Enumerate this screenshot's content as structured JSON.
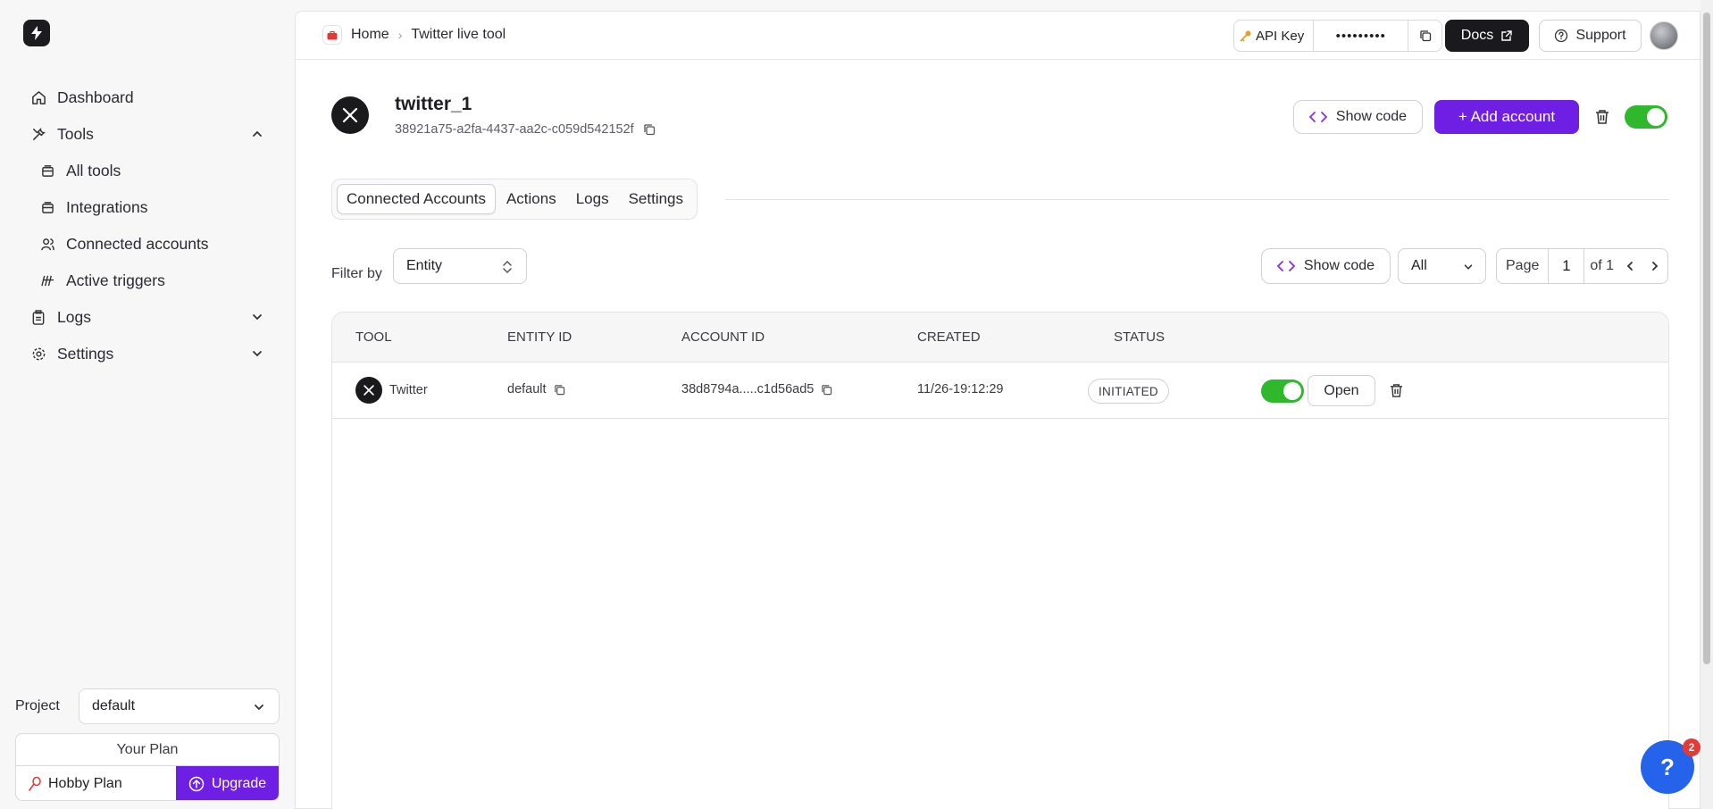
{
  "sidebar": {
    "items": [
      {
        "label": "Dashboard",
        "icon": "home-icon"
      },
      {
        "label": "Tools",
        "icon": "tools-icon"
      },
      {
        "label": "All tools",
        "icon": "grid-icon"
      },
      {
        "label": "Integrations",
        "icon": "integration-icon"
      },
      {
        "label": "Connected accounts",
        "icon": "users-icon"
      },
      {
        "label": "Active triggers",
        "icon": "trigger-icon"
      },
      {
        "label": "Logs",
        "icon": "clipboard-icon"
      },
      {
        "label": "Settings",
        "icon": "gear-icon"
      }
    ],
    "project_label": "Project",
    "project_value": "default",
    "plan_title": "Your Plan",
    "plan_name": "Hobby Plan",
    "upgrade_label": "Upgrade"
  },
  "header": {
    "breadcrumb_home": "Home",
    "breadcrumb_current": "Twitter live tool",
    "api_key_label": "API Key",
    "api_key_value": "•••••••••",
    "docs_label": "Docs",
    "support_label": "Support"
  },
  "tool": {
    "name": "twitter_1",
    "id": "38921a75-a2fa-4437-aa2c-c059d542152f",
    "show_code_label": "Show code",
    "add_account_label": "+ Add account"
  },
  "tabs": [
    "Connected Accounts",
    "Actions",
    "Logs",
    "Settings"
  ],
  "filters": {
    "filter_by_label": "Filter by",
    "entity_value": "Entity",
    "show_code_label": "Show code",
    "status_value": "All",
    "page_label": "Page",
    "page_number": "1",
    "page_of": "of 1"
  },
  "table": {
    "columns": [
      "TOOL",
      "ENTITY ID",
      "ACCOUNT ID",
      "CREATED",
      "STATUS"
    ],
    "rows": [
      {
        "tool": "Twitter",
        "entity_id": "default",
        "account_id": "38d8794a.....c1d56ad5",
        "created": "11/26-19:12:29",
        "status": "INITIATED",
        "open_label": "Open"
      }
    ]
  },
  "help": {
    "label": "?",
    "badge": "2"
  },
  "colors": {
    "accent": "#6e1fe3",
    "toggle_on": "#2fb82c",
    "help": "#2563eb"
  }
}
